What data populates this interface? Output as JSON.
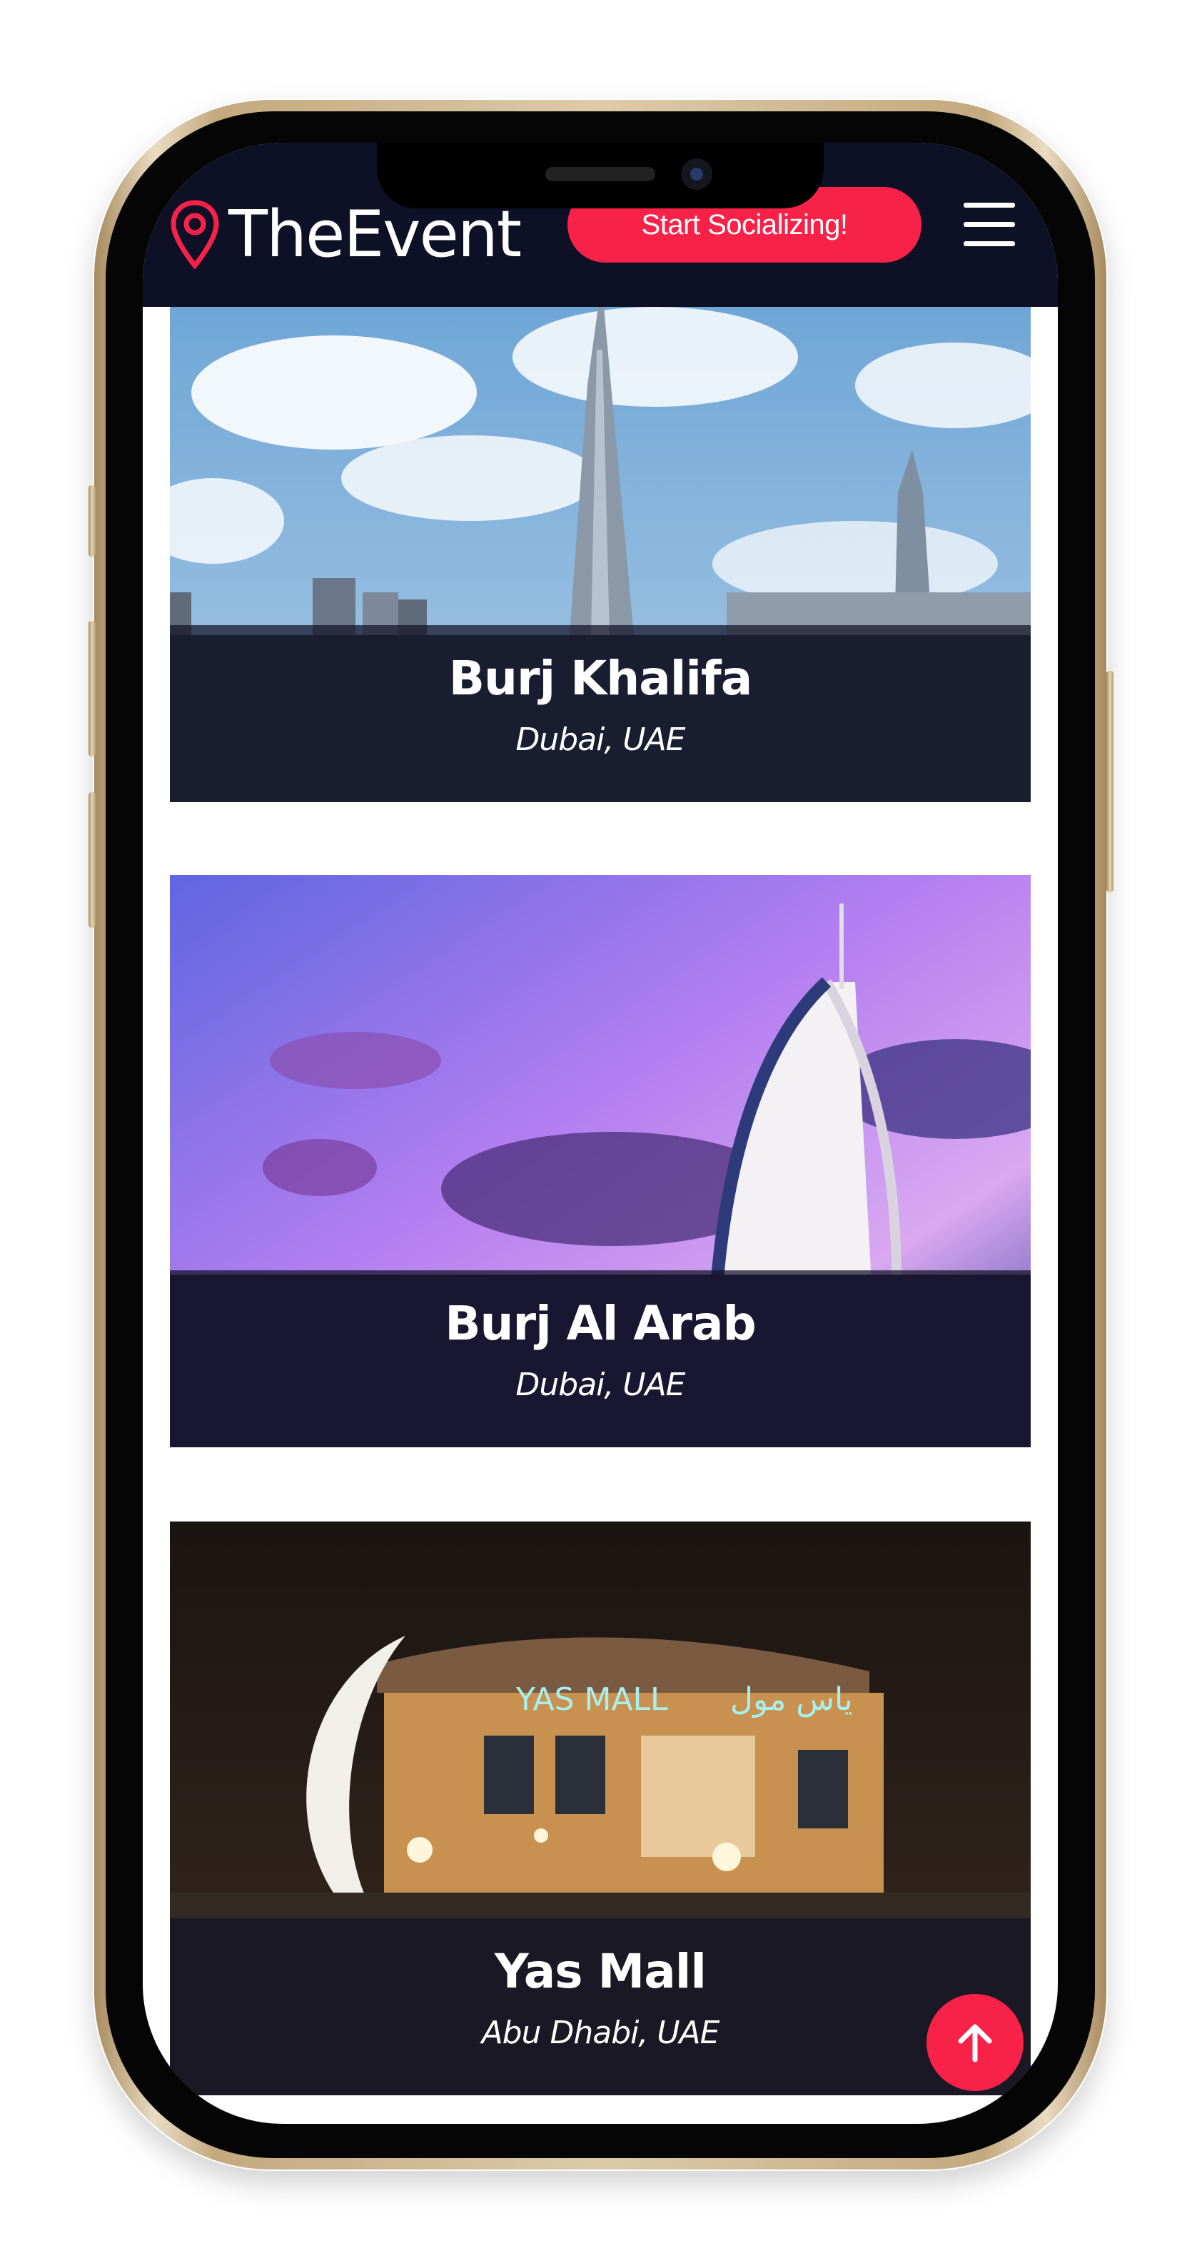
{
  "header": {
    "brand": "TheEvent",
    "cta_label": "Start Socializing!",
    "menu_icon": "hamburger-icon",
    "logo_icon": "map-pin-icon"
  },
  "venues": [
    {
      "name": "Burj Khalifa",
      "location": "Dubai, UAE"
    },
    {
      "name": "Burj Al Arab",
      "location": "Dubai, UAE"
    },
    {
      "name": "Yas Mall",
      "location": "Abu Dhabi, UAE"
    }
  ],
  "yas_mall_sign": {
    "latin": "YAS MALL",
    "arabic": "ياس مول"
  },
  "back_to_top_icon": "arrow-up-icon",
  "colors": {
    "accent": "#f82249",
    "header_bg": "#0e1026",
    "phone_frame": "#c4a97f"
  }
}
